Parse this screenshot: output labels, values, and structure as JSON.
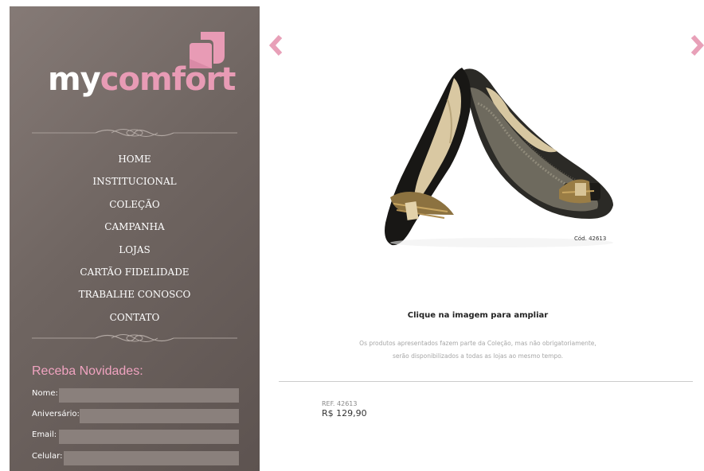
{
  "brand": {
    "part1": "my",
    "part2": "comfort"
  },
  "nav": {
    "items": [
      {
        "label": "HOME"
      },
      {
        "label": "INSTITUCIONAL"
      },
      {
        "label": "COLEÇÃO"
      },
      {
        "label": "CAMPANHA"
      },
      {
        "label": "LOJAS"
      },
      {
        "label": "CARTÃO FIDELIDADE"
      },
      {
        "label": "TRABALHE CONOSCO"
      },
      {
        "label": "CONTATO"
      }
    ]
  },
  "newsletter": {
    "title": "Receba Novidades:",
    "fields": [
      {
        "label": "Nome:",
        "value": ""
      },
      {
        "label": "Aniversário:",
        "value": ""
      },
      {
        "label": "Email:",
        "value": ""
      },
      {
        "label": "Celular:",
        "value": ""
      }
    ]
  },
  "product": {
    "image_code": "Cód. 42613",
    "cta": "Clique na imagem para ampliar",
    "disclaimer_line1": "Os produtos apresentados fazem parte da Coleção, mas não obrigatoriamente,",
    "disclaimer_line2": "serão disponibilizados a todas as lojas ao mesmo tempo.",
    "ref": "REF. 42613",
    "price": "R$ 129,90"
  },
  "icons": {
    "prev": "chevron-left-icon",
    "next": "chevron-right-icon"
  },
  "colors": {
    "accent_pink": "#e89bb5",
    "sidebar": "#6f6561",
    "arrow": "#e8a0b8"
  }
}
